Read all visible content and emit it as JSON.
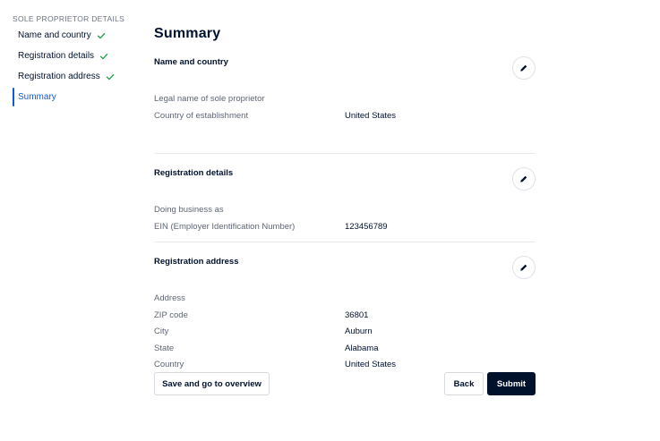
{
  "sidebar": {
    "title": "SOLE PROPRIETOR DETAILS",
    "steps": [
      {
        "label": "Name and country",
        "status": "complete"
      },
      {
        "label": "Registration details",
        "status": "complete"
      },
      {
        "label": "Registration address",
        "status": "complete"
      },
      {
        "label": "Summary",
        "status": "current"
      }
    ]
  },
  "main": {
    "title": "Summary",
    "sections": [
      {
        "title": "Name and country",
        "rows": [
          {
            "label": "Legal name of sole proprietor",
            "value": ""
          },
          {
            "label": "Country of establishment",
            "value": "United States"
          }
        ]
      },
      {
        "title": "Registration details",
        "rows": [
          {
            "label": "Doing business as",
            "value": ""
          },
          {
            "label": "EIN (Employer Identification Number)",
            "value": "123456789"
          }
        ]
      },
      {
        "title": "Registration address",
        "rows": [
          {
            "label": "Address",
            "value": ""
          },
          {
            "label": "ZIP code",
            "value": "36801"
          },
          {
            "label": "City",
            "value": "Auburn"
          },
          {
            "label": "State",
            "value": "Alabama"
          },
          {
            "label": "Country",
            "value": "United States"
          }
        ]
      }
    ]
  },
  "footer": {
    "save_label": "Save and go to overview",
    "back_label": "Back",
    "submit_label": "Submit"
  },
  "colors": {
    "primary": "#00112c",
    "accent": "#0b5bdc",
    "check": "#1e9e4a"
  },
  "icons": {
    "complete": "checkmark-icon",
    "edit": "pencil-icon"
  }
}
